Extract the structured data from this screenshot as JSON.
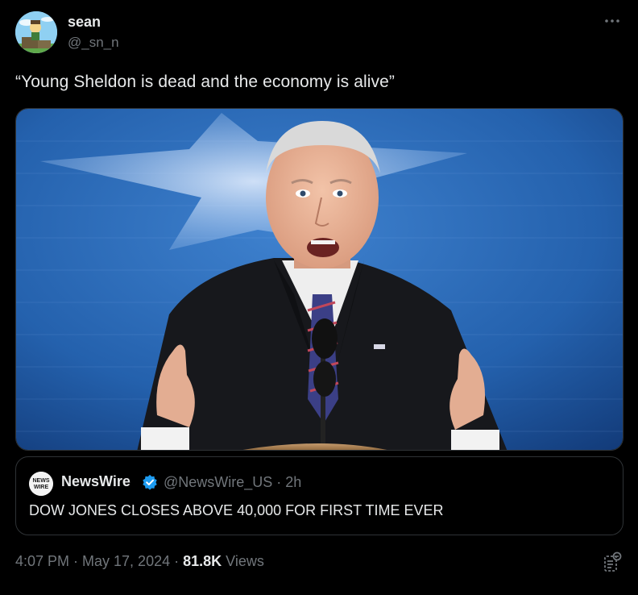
{
  "author": {
    "name": "sean",
    "handle": "@_sn_n",
    "avatar_icon": "cartoon-avatar"
  },
  "tweet": {
    "text": "“Young Sheldon is dead and the economy is alive”"
  },
  "media": {
    "alt_icon": "photo"
  },
  "quote": {
    "avatar_label": "NEWS WIRE",
    "name": "NewsWire",
    "verified_icon": "verified-badge",
    "meta": "@NewsWire_US · 2h",
    "text": "DOW JONES CLOSES ABOVE 40,000 FOR FIRST TIME EVER"
  },
  "footer": {
    "time_date": "4:07 PM · May 17, 2024 · ",
    "views_count": "81.8K",
    "views_label": " Views"
  },
  "colors": {
    "background": "#000000",
    "text": "#e7e9ea",
    "muted": "#71767b",
    "border": "#2f3336",
    "verified": "#1d9bf0"
  }
}
